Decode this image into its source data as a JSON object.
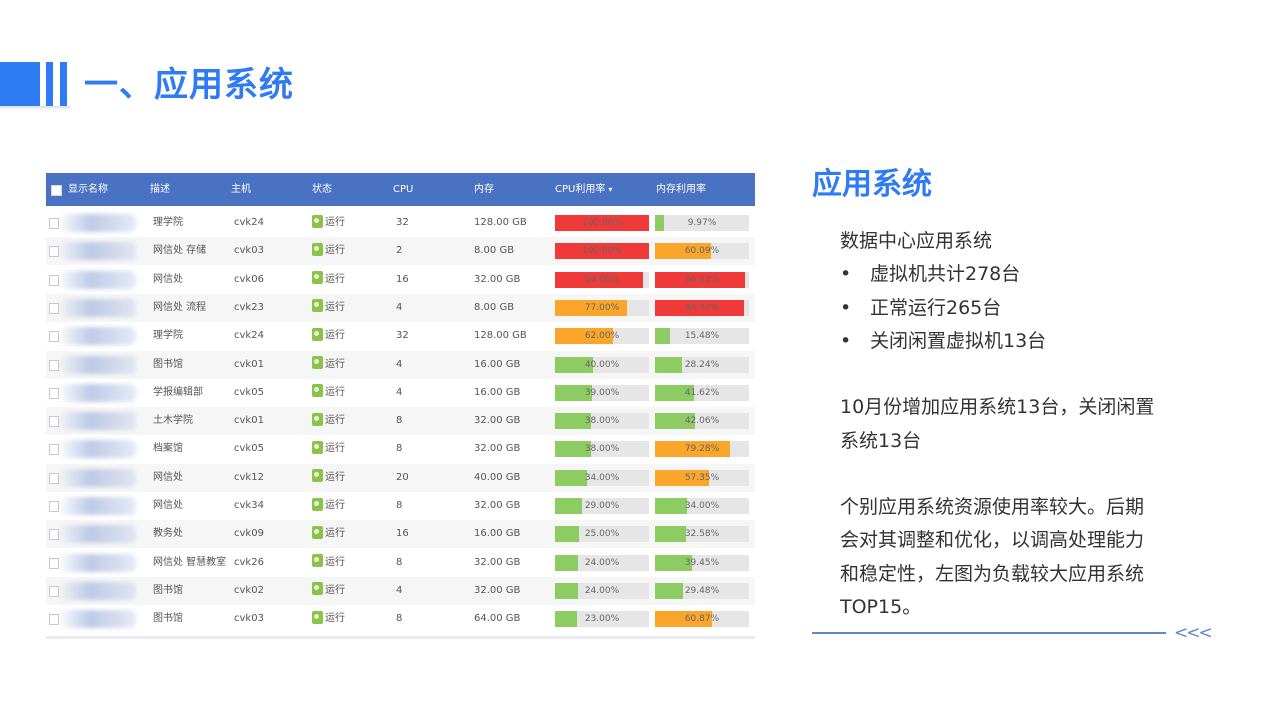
{
  "header": {
    "title": "一、应用系统"
  },
  "table": {
    "columns": [
      "显示名称",
      "描述",
      "主机",
      "状态",
      "CPU",
      "内存",
      "CPU利用率",
      "内存利用率"
    ],
    "sort_indicator": "▾",
    "status_text": "运行",
    "rows": [
      {
        "desc": "理学院",
        "host": "cvk24",
        "cpu": "32",
        "mem": "128.00 GB",
        "cpu_pct": 100.0,
        "cpu_label": "100.00%",
        "mem_pct": 9.97,
        "mem_label": "9.97%"
      },
      {
        "desc": "网信处 存储",
        "host": "cvk03",
        "cpu": "2",
        "mem": "8.00 GB",
        "cpu_pct": 100.0,
        "cpu_label": "100.00%",
        "mem_pct": 60.09,
        "mem_label": "60.09%"
      },
      {
        "desc": "网信处",
        "host": "cvk06",
        "cpu": "16",
        "mem": "32.00 GB",
        "cpu_pct": 94.0,
        "cpu_label": "94.00%",
        "mem_pct": 96.22,
        "mem_label": "96.22%"
      },
      {
        "desc": "网信处 流程",
        "host": "cvk23",
        "cpu": "4",
        "mem": "8.00 GB",
        "cpu_pct": 77.0,
        "cpu_label": "77.00%",
        "mem_pct": 94.32,
        "mem_label": "94.32%"
      },
      {
        "desc": "理学院",
        "host": "cvk24",
        "cpu": "32",
        "mem": "128.00 GB",
        "cpu_pct": 62.0,
        "cpu_label": "62.00%",
        "mem_pct": 15.48,
        "mem_label": "15.48%"
      },
      {
        "desc": "图书馆",
        "host": "cvk01",
        "cpu": "4",
        "mem": "16.00 GB",
        "cpu_pct": 40.0,
        "cpu_label": "40.00%",
        "mem_pct": 28.24,
        "mem_label": "28.24%"
      },
      {
        "desc": "学报编辑部",
        "host": "cvk05",
        "cpu": "4",
        "mem": "16.00 GB",
        "cpu_pct": 39.0,
        "cpu_label": "39.00%",
        "mem_pct": 41.62,
        "mem_label": "41.62%"
      },
      {
        "desc": "土木学院",
        "host": "cvk01",
        "cpu": "8",
        "mem": "32.00 GB",
        "cpu_pct": 38.0,
        "cpu_label": "38.00%",
        "mem_pct": 42.06,
        "mem_label": "42.06%"
      },
      {
        "desc": "档案馆",
        "host": "cvk05",
        "cpu": "8",
        "mem": "32.00 GB",
        "cpu_pct": 38.0,
        "cpu_label": "38.00%",
        "mem_pct": 79.28,
        "mem_label": "79.28%"
      },
      {
        "desc": "网信处",
        "host": "cvk12",
        "cpu": "20",
        "mem": "40.00 GB",
        "cpu_pct": 34.0,
        "cpu_label": "34.00%",
        "mem_pct": 57.35,
        "mem_label": "57.35%"
      },
      {
        "desc": "网信处",
        "host": "cvk34",
        "cpu": "8",
        "mem": "32.00 GB",
        "cpu_pct": 29.0,
        "cpu_label": "29.00%",
        "mem_pct": 34.0,
        "mem_label": "34.00%"
      },
      {
        "desc": "教务处",
        "host": "cvk09",
        "cpu": "16",
        "mem": "16.00 GB",
        "cpu_pct": 25.0,
        "cpu_label": "25.00%",
        "mem_pct": 32.58,
        "mem_label": "32.58%"
      },
      {
        "desc": "网信处 智慧教室",
        "host": "cvk26",
        "cpu": "8",
        "mem": "32.00 GB",
        "cpu_pct": 24.0,
        "cpu_label": "24.00%",
        "mem_pct": 39.45,
        "mem_label": "39.45%"
      },
      {
        "desc": "图书馆",
        "host": "cvk02",
        "cpu": "4",
        "mem": "32.00 GB",
        "cpu_pct": 24.0,
        "cpu_label": "24.00%",
        "mem_pct": 29.48,
        "mem_label": "29.48%"
      },
      {
        "desc": "图书馆",
        "host": "cvk03",
        "cpu": "8",
        "mem": "64.00 GB",
        "cpu_pct": 23.0,
        "cpu_label": "23.00%",
        "mem_pct": 60.87,
        "mem_label": "60.87%"
      }
    ]
  },
  "colors": {
    "accent": "#2f7bf3",
    "table_header": "#4a72c2",
    "bar_red": "#f03a3a",
    "bar_orange": "#f9a62b",
    "bar_green": "#8ccc63",
    "track": "#e6e6e6"
  },
  "summary": {
    "title": "应用系统",
    "intro": "数据中心应用系统",
    "bullet_symbol": "•",
    "bullets": [
      "虚拟机共计278台",
      "正常运行265台",
      "关闭闲置虚拟机13台"
    ],
    "para1": [
      "10月份增加应用系统13台，关闭闲置",
      "系统13台"
    ],
    "para2": [
      "个别应用系统资源使用率较大。后期",
      "会对其调整和优化，以调高处理能力",
      "和稳定性，左图为负载较大应用系统",
      "TOP15。"
    ],
    "decor": "<<<"
  }
}
